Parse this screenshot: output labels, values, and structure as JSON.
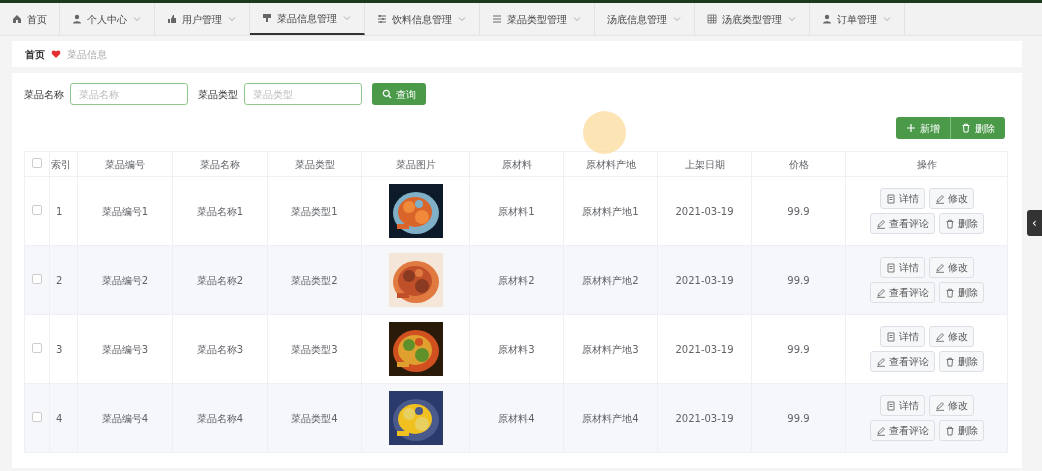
{
  "nav_tabs": [
    {
      "label": "首页",
      "dropdown": false,
      "selected": false
    },
    {
      "label": "个人中心",
      "dropdown": true,
      "selected": false
    },
    {
      "label": "用户管理",
      "dropdown": true,
      "selected": false
    },
    {
      "label": "菜品信息管理",
      "dropdown": true,
      "selected": true
    },
    {
      "label": "饮料信息管理",
      "dropdown": true,
      "selected": false
    },
    {
      "label": "菜品类型管理",
      "dropdown": true,
      "selected": false
    },
    {
      "label": "汤底信息管理",
      "dropdown": true,
      "selected": false
    },
    {
      "label": "汤底类型管理",
      "dropdown": true,
      "selected": false
    },
    {
      "label": "订单管理",
      "dropdown": true,
      "selected": false
    }
  ],
  "breadcrumb": [
    "首页",
    "菜品信息"
  ],
  "search": {
    "fields": [
      {
        "label": "菜品名称",
        "placeholder": "菜品名称"
      },
      {
        "label": "菜品类型",
        "placeholder": "菜品类型"
      }
    ],
    "button": "查询"
  },
  "toolbar": [
    {
      "label": "新增",
      "kind": "add"
    },
    {
      "label": "删除",
      "kind": "delete"
    }
  ],
  "table": {
    "select_all_checked": false,
    "columns": [
      "索引",
      "菜品编号",
      "菜品名称",
      "菜品类型",
      "菜品图片",
      "原材料",
      "原材料产地",
      "上架日期",
      "价格",
      "操作"
    ],
    "rows": [
      {
        "checked": false,
        "cells": [
          "1",
          "菜品编号1",
          "菜品名称1",
          "菜品类型1",
          "",
          "原材料1",
          "原材料产地1",
          "2021-03-19",
          "99.9"
        ],
        "actions": [
          "详情",
          "修改",
          "查看评论",
          "删除"
        ]
      },
      {
        "checked": false,
        "cells": [
          "2",
          "菜品编号2",
          "菜品名称2",
          "菜品类型2",
          "",
          "原材料2",
          "原材料产地2",
          "2021-03-19",
          "99.9"
        ],
        "actions": [
          "详情",
          "修改",
          "查看评论",
          "删除"
        ]
      },
      {
        "checked": false,
        "cells": [
          "3",
          "菜品编号3",
          "菜品名称3",
          "菜品类型3",
          "",
          "原材料3",
          "原材料产地3",
          "2021-03-19",
          "99.9"
        ],
        "actions": [
          "详情",
          "修改",
          "查看评论",
          "删除"
        ]
      },
      {
        "checked": false,
        "cells": [
          "4",
          "菜品编号4",
          "菜品名称4",
          "菜品类型4",
          "",
          "原材料4",
          "原材料产地4",
          "2021-03-19",
          "99.9"
        ],
        "actions": [
          "详情",
          "修改",
          "查看评论",
          "删除"
        ]
      }
    ]
  },
  "side_handle": "‹"
}
